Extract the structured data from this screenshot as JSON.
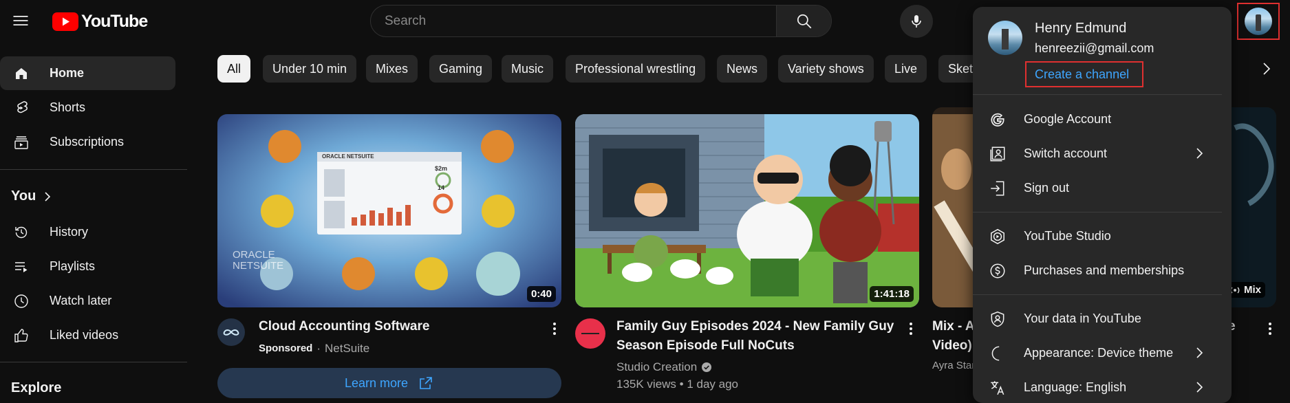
{
  "header": {
    "logo_text": "YouTube",
    "search_placeholder": "Search"
  },
  "sidebar": {
    "main_items": [
      {
        "label": "Home",
        "icon": "home-icon",
        "active": true
      },
      {
        "label": "Shorts",
        "icon": "shorts-icon"
      },
      {
        "label": "Subscriptions",
        "icon": "subscriptions-icon"
      }
    ],
    "you_heading": "You",
    "you_items": [
      {
        "label": "History",
        "icon": "history-icon"
      },
      {
        "label": "Playlists",
        "icon": "playlists-icon"
      },
      {
        "label": "Watch later",
        "icon": "watch-later-icon"
      },
      {
        "label": "Liked videos",
        "icon": "liked-videos-icon"
      }
    ],
    "explore_heading": "Explore"
  },
  "chips": [
    "All",
    "Under 10 min",
    "Mixes",
    "Gaming",
    "Music",
    "Professional wrestling",
    "News",
    "Variety shows",
    "Live",
    "Sketch"
  ],
  "videos": [
    {
      "title": "Cloud Accounting Software",
      "sponsored_label": "Sponsored",
      "separator": "·",
      "channel": "NetSuite",
      "duration": "0:40",
      "cta": "Learn more",
      "thumb_banner": "ORACLE NETSUITE",
      "thumb_watermark": "ORACLE NETSUITE",
      "thumb_values": [
        "$2m",
        "14"
      ]
    },
    {
      "title_line1": "Family Guy Episodes 2024 - New Family Guy",
      "title_line2": "Season Episode Full NoCuts",
      "channel": "Studio Creation",
      "stats": "135K views • 1 day ago",
      "duration": "1:41:18"
    },
    {
      "title_line1": "Mix - A",
      "title_line2": "Video)",
      "channel": "Ayra Star",
      "badge": "Mix",
      "title_end": "e"
    }
  ],
  "account_menu": {
    "name": "Henry Edmund",
    "email": "henreezii@gmail.com",
    "create_channel": "Create a channel",
    "items_group1": [
      {
        "label": "Google Account",
        "icon": "google-icon"
      },
      {
        "label": "Switch account",
        "icon": "switch-account-icon",
        "chevron": true
      },
      {
        "label": "Sign out",
        "icon": "sign-out-icon"
      }
    ],
    "items_group2": [
      {
        "label": "YouTube Studio",
        "icon": "youtube-studio-icon"
      },
      {
        "label": "Purchases and memberships",
        "icon": "purchases-icon"
      }
    ],
    "items_group3": [
      {
        "label": "Your data in YouTube",
        "icon": "your-data-icon"
      },
      {
        "label": "Appearance: Device theme",
        "icon": "appearance-icon",
        "chevron": true
      },
      {
        "label": "Language: English",
        "icon": "language-icon",
        "chevron": true
      }
    ]
  },
  "colors": {
    "background": "#0f0f0f",
    "chip": "#272727",
    "menu": "#282828",
    "link": "#3ea6ff",
    "highlight_box": "#e03030",
    "brand_red": "#ff0000"
  }
}
